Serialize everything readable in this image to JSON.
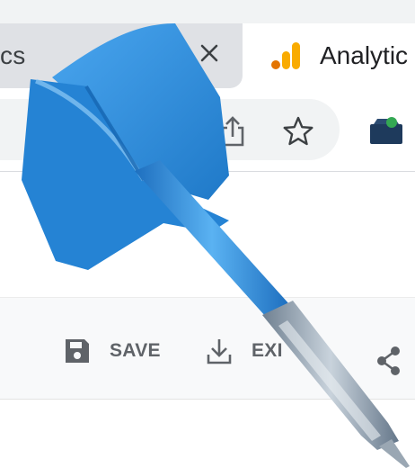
{
  "browser": {
    "tabs": [
      {
        "label": "cs",
        "active": false
      },
      {
        "label": "Analytic",
        "active": true
      }
    ]
  },
  "toolbar": {
    "icons": [
      "share-page-icon",
      "star-icon",
      "extension-icon"
    ]
  },
  "report_actions": {
    "save_label": "SAVE",
    "export_label": "EXI"
  },
  "icons": [
    "close-icon",
    "analytics-icon",
    "save-icon",
    "download-icon",
    "share-icon",
    "dart-icon"
  ],
  "colors": {
    "analytics_orange": "#f9ab00",
    "analytics_dark_orange": "#e37400",
    "dart_blue": "#2f8ad8",
    "action_gray": "#5f6368",
    "chrome_gray": "#dfe1e5"
  }
}
